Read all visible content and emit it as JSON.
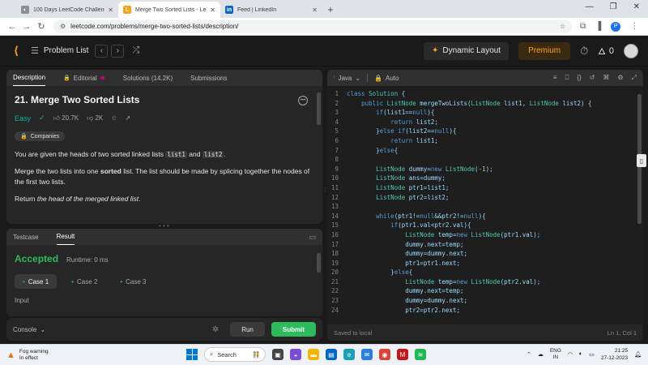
{
  "browser": {
    "tabs": [
      {
        "title": "100 Days LeetCode Challenge",
        "icon": "globe-icon",
        "active": false
      },
      {
        "title": "Merge Two Sorted Lists - LeetC",
        "icon": "leetcode-icon",
        "active": true
      },
      {
        "title": "Feed | LinkedIn",
        "icon": "linkedin-icon",
        "active": false
      }
    ],
    "new_tab_label": "+",
    "url": "leetcode.com/problems/merge-two-sorted-lists/description/",
    "profile_letter": "P"
  },
  "header": {
    "problem_list": "Problem List",
    "dynamic_layout": "Dynamic Layout",
    "premium": "Premium",
    "streak": "0"
  },
  "description_tabs": [
    {
      "label": "Description",
      "active": true
    },
    {
      "label": "Editorial",
      "active": false
    },
    {
      "label": "Solutions (14.2K)",
      "active": false
    },
    {
      "label": "Submissions",
      "active": false
    }
  ],
  "problem": {
    "title": "21. Merge Two Sorted Lists",
    "difficulty": "Easy",
    "likes": "20.7K",
    "dislikes": "2K",
    "companies": "Companies",
    "p1_before": "You are given the heads of two sorted linked lists ",
    "p1_code1": "list1",
    "p1_mid": " and ",
    "p1_code2": "list2",
    "p1_after": ".",
    "p2_before": "Merge the two lists into one ",
    "p2_bold": "sorted",
    "p2_after": " list. The list should be made by splicing together the nodes of the first two lists.",
    "p3_before": "Return ",
    "p3_italic": "the head of the merged linked list",
    "p3_after": "."
  },
  "test_tabs": [
    {
      "label": "Testcase",
      "active": false
    },
    {
      "label": "Result",
      "active": true
    }
  ],
  "result": {
    "status": "Accepted",
    "runtime": "Runtime: 0 ms",
    "cases": [
      "Case 1",
      "Case 2",
      "Case 3"
    ],
    "input_label": "Input"
  },
  "console": {
    "label": "Console",
    "run": "Run",
    "submit": "Submit"
  },
  "editor": {
    "language": "Java",
    "mode": "Auto",
    "lines": [
      "class Solution {",
      "    public ListNode mergeTwoLists(ListNode list1, ListNode list2) {",
      "        if(list1==null){",
      "            return list2;",
      "        }else if(list2==null){",
      "            return list1;",
      "        }else{",
      "",
      "        ListNode dummy=new ListNode(-1);",
      "        ListNode ans=dummy;",
      "        ListNode ptr1=list1;",
      "        ListNode ptr2=list2;",
      "",
      "        while(ptr1!=null&&ptr2!=null){",
      "            if(ptr1.val<ptr2.val){",
      "                ListNode temp=new ListNode(ptr1.val);",
      "                dummy.next=temp;",
      "                dummy=dummy.next;",
      "                ptr1=ptr1.next;",
      "            }else{",
      "                ListNode temp=new ListNode(ptr2.val);",
      "                dummy.next=temp;",
      "                dummy=dummy.next;",
      "                ptr2=ptr2.next;"
    ],
    "status_left": "Saved to local",
    "status_right": "Ln 1, Col 1"
  },
  "taskbar": {
    "weather_title": "Fog warning",
    "weather_sub": "In effect",
    "search": "Search",
    "lang_top": "ENG",
    "lang_bottom": "IN",
    "time": "21:25",
    "date": "27-12-2023"
  },
  "colors": {
    "accent_orange": "#ffa116",
    "accepted_green": "#2cbb5d",
    "easy_teal": "#00b8a3",
    "keyword_blue": "#569cd6",
    "type_teal": "#4ec9b0"
  }
}
